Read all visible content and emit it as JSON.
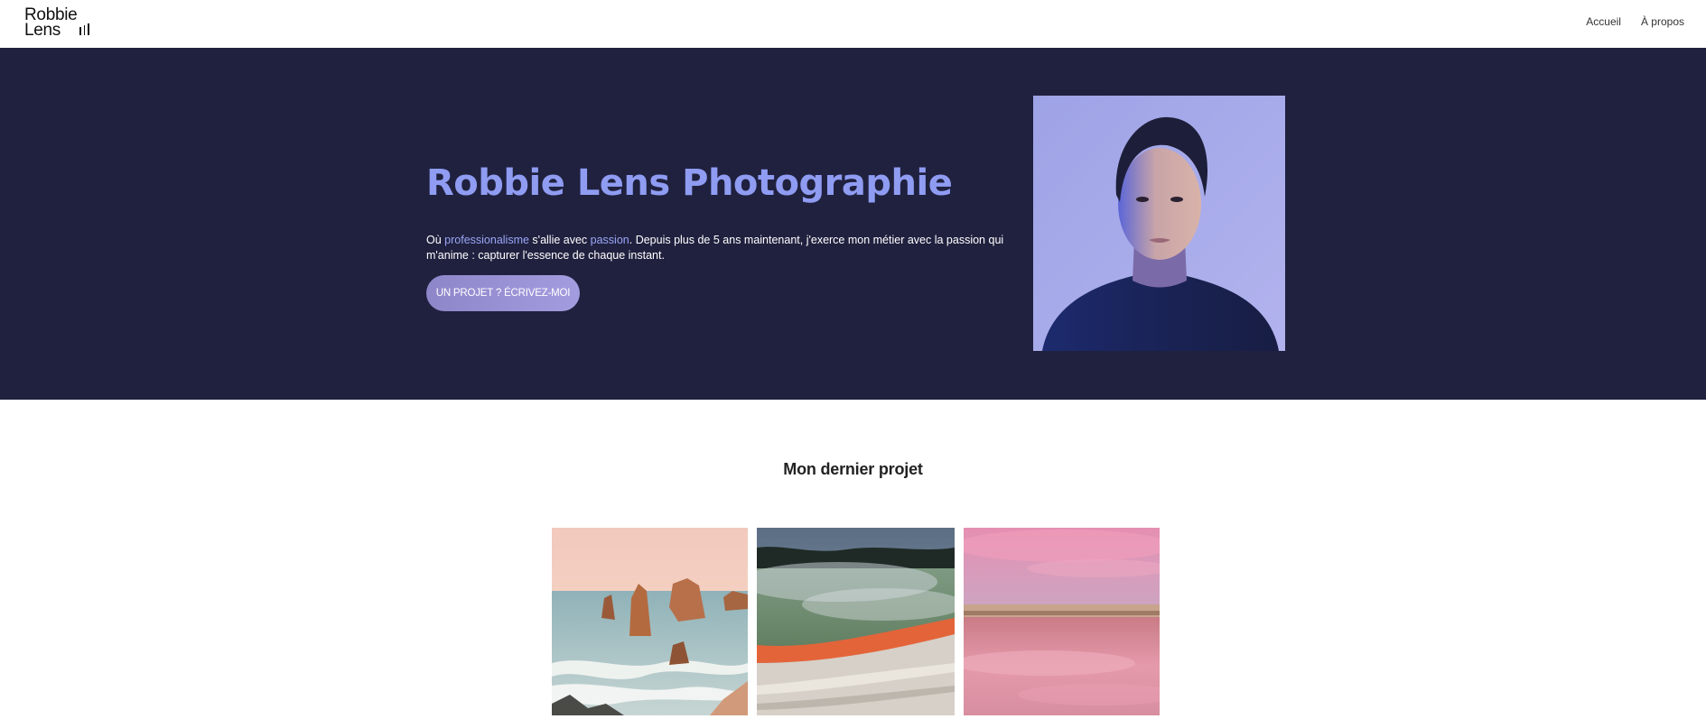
{
  "header": {
    "logo_line1": "Robbie",
    "logo_line2": "Lens",
    "nav": [
      {
        "label": "Accueil"
      },
      {
        "label": "À propos"
      }
    ]
  },
  "hero": {
    "title": "Robbie Lens Photographie",
    "desc_prefix": "Où ",
    "desc_highlight1": "professionalisme",
    "desc_mid": " s'allie avec ",
    "desc_highlight2": "passion",
    "desc_suffix": ". Depuis plus de 5 ans maintenant, j'exerce mon métier avec la passion qui m'anime : capturer l'essence de chaque instant.",
    "cta_label": "UN PROJET ? ÉCRIVEZ-MOI"
  },
  "project": {
    "heading": "Mon dernier projet"
  },
  "colors": {
    "hero_bg": "#20213f",
    "accent": "#8f9cf2",
    "button": "#9a94d8"
  }
}
